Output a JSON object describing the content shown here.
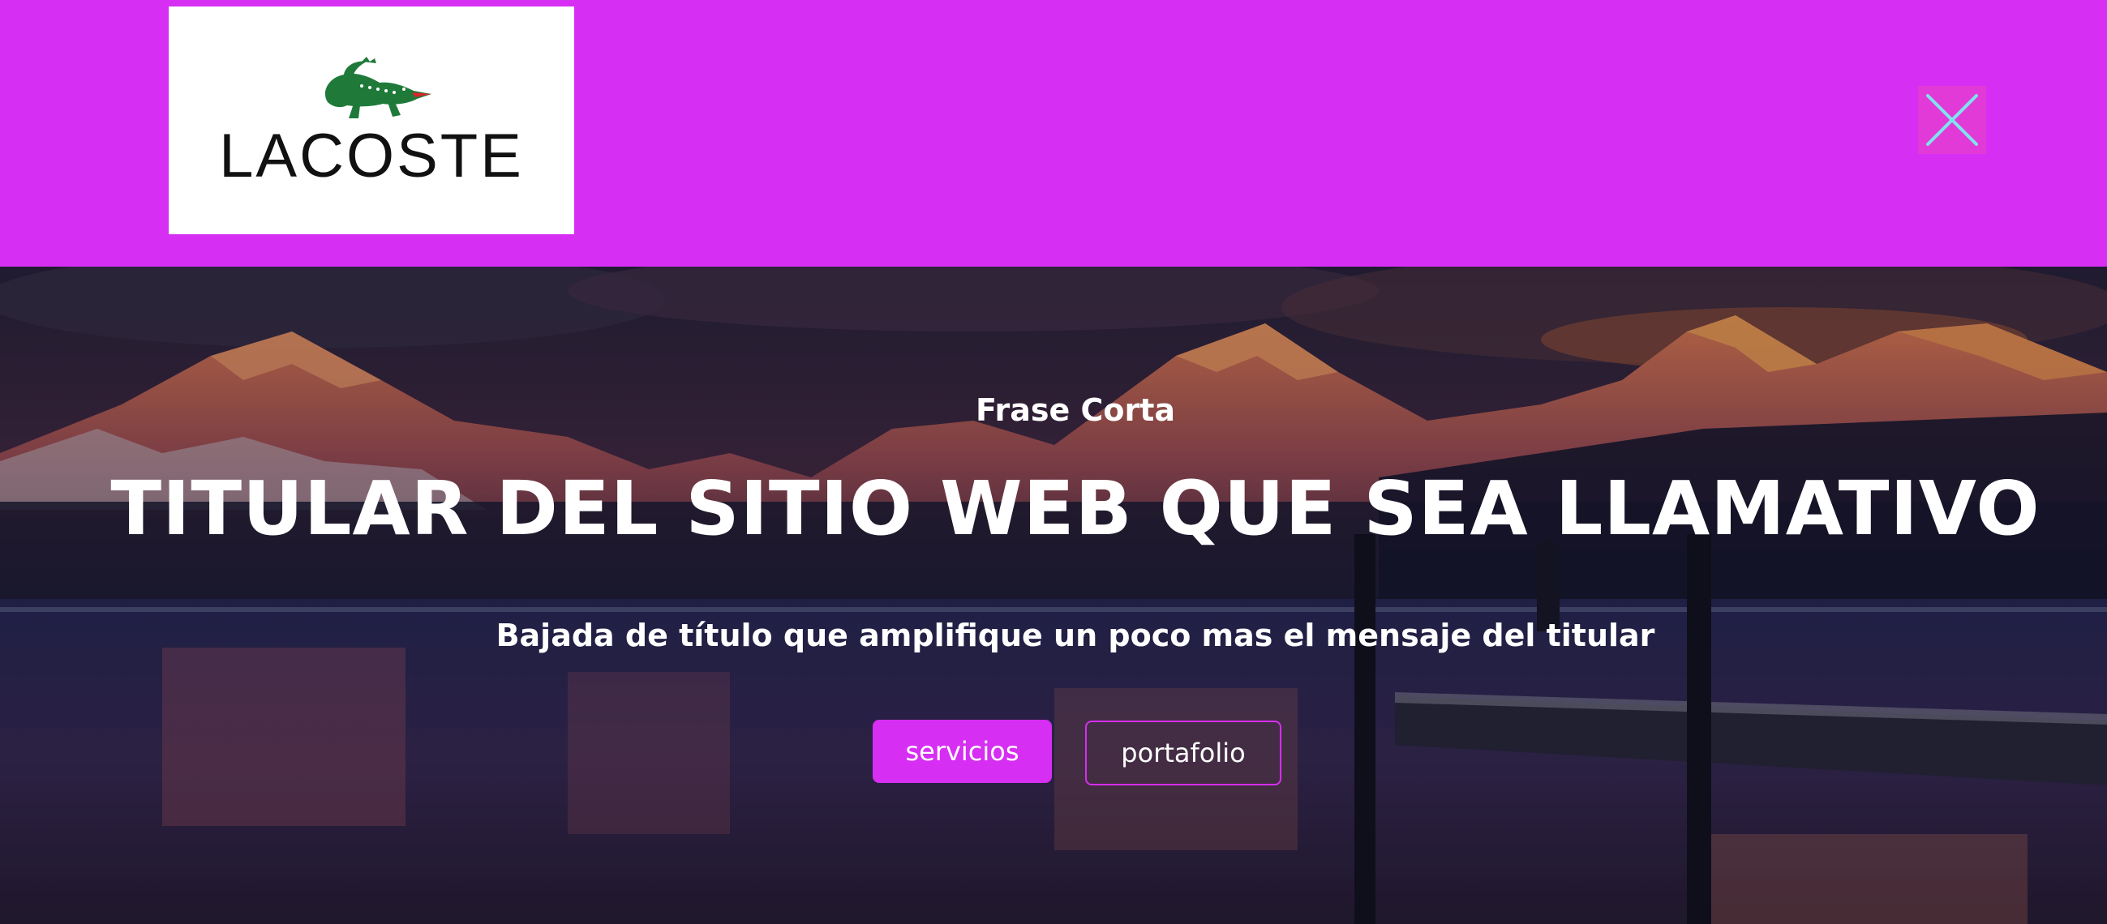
{
  "header": {
    "background_color": "#d62ef2",
    "logo": {
      "brand_text": "LACOSTE",
      "icon": "crocodile-logo-icon"
    },
    "close_button": {
      "icon": "close-icon",
      "icon_color": "#7fe3ee"
    }
  },
  "hero": {
    "eyebrow": "Frase Corta",
    "headline": "TITULAR DEL SITIO WEB QUE SEA LLAMATIVO",
    "subheadline": "Bajada de título que amplifique un poco mas el mensaje del titular",
    "buttons": {
      "primary_label": "servicios",
      "secondary_label": "portafolio"
    },
    "accent_color": "#d62ef2"
  }
}
